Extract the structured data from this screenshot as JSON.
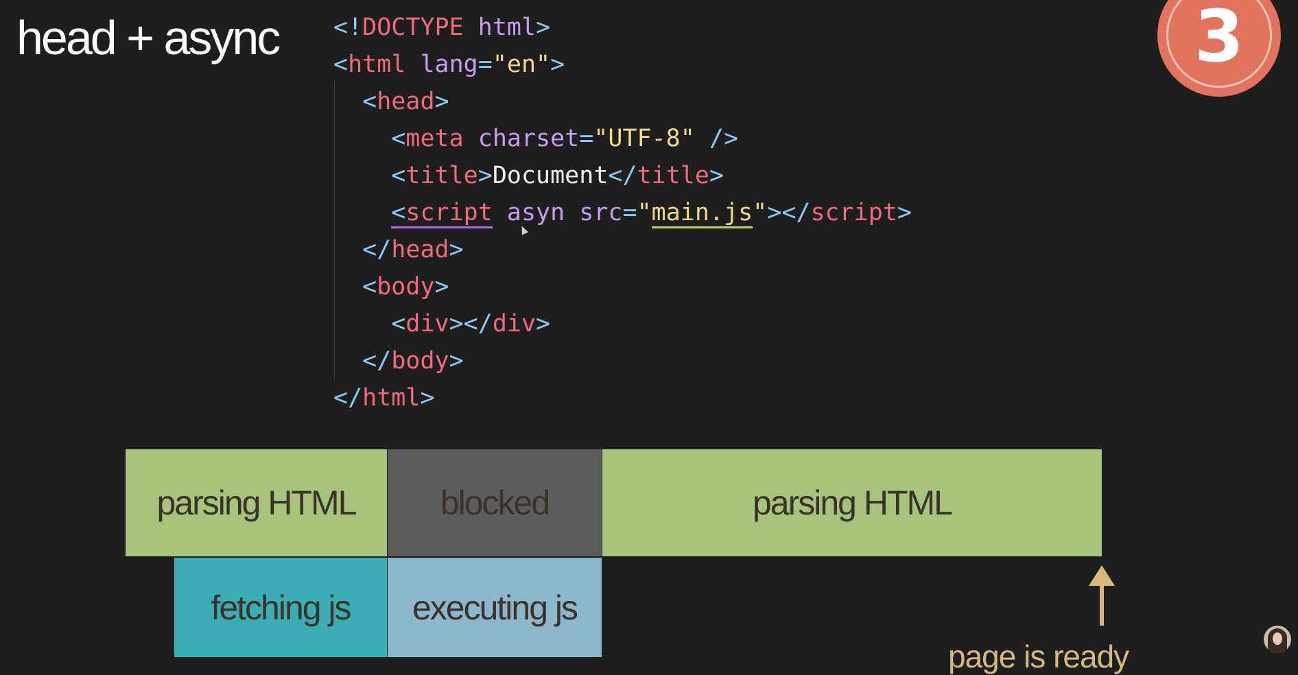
{
  "slide": {
    "title": "head + async",
    "badge_number": "3"
  },
  "code": {
    "l1": {
      "open": "<!",
      "doctype": "DOCTYPE",
      "html": " html",
      "close": ">"
    },
    "l2": {
      "open": "<",
      "tag": "html",
      "attr": " lang",
      "eq": "=",
      "val": "\"en\"",
      "close": ">"
    },
    "l3": {
      "indent": "  ",
      "open": "<",
      "tag": "head",
      "close": ">"
    },
    "l4": {
      "indent": "    ",
      "open": "<",
      "tag": "meta",
      "attr": " charset",
      "eq": "=",
      "val": "\"UTF-8\"",
      "slash": " />"
    },
    "l5": {
      "indent": "    ",
      "open": "<",
      "tag": "title",
      "close": ">",
      "text": "Document",
      "endopen": "</",
      "endtag": "title",
      "endclose": ">"
    },
    "l6": {
      "indent": "    ",
      "open": "<",
      "tag": "script",
      "sp": " ",
      "attr1": "asyn",
      "attr2": " src",
      "eq": "=",
      "q1": "\"",
      "val": "main.js",
      "q2": "\"",
      "close": ">",
      "endopen": "</",
      "endtag": "script",
      "endclose": ">"
    },
    "l7": {
      "indent": "  ",
      "open": "</",
      "tag": "head",
      "close": ">"
    },
    "l8": {
      "indent": "  ",
      "open": "<",
      "tag": "body",
      "close": ">"
    },
    "l9": {
      "indent": "    ",
      "open": "<",
      "tag": "div",
      "close": "></",
      "endtag": "div",
      "endclose": ">"
    },
    "l10": {
      "indent": "  ",
      "open": "</",
      "tag": "body",
      "close": ">"
    },
    "l11": {
      "open": "</",
      "tag": "html",
      "close": ">"
    }
  },
  "timeline": {
    "parsing_1": "parsing HTML",
    "blocked": "blocked",
    "parsing_2": "parsing HTML",
    "fetching": "fetching js",
    "executing": "executing js",
    "ready_label": "page is ready"
  },
  "colors": {
    "parsing": "#a6c47c",
    "blocked": "#5c5c5c",
    "fetching": "#3aadb5",
    "executing": "#8bb6cc",
    "accent_arrow": "#d6b97a",
    "badge": "#e2735f"
  }
}
